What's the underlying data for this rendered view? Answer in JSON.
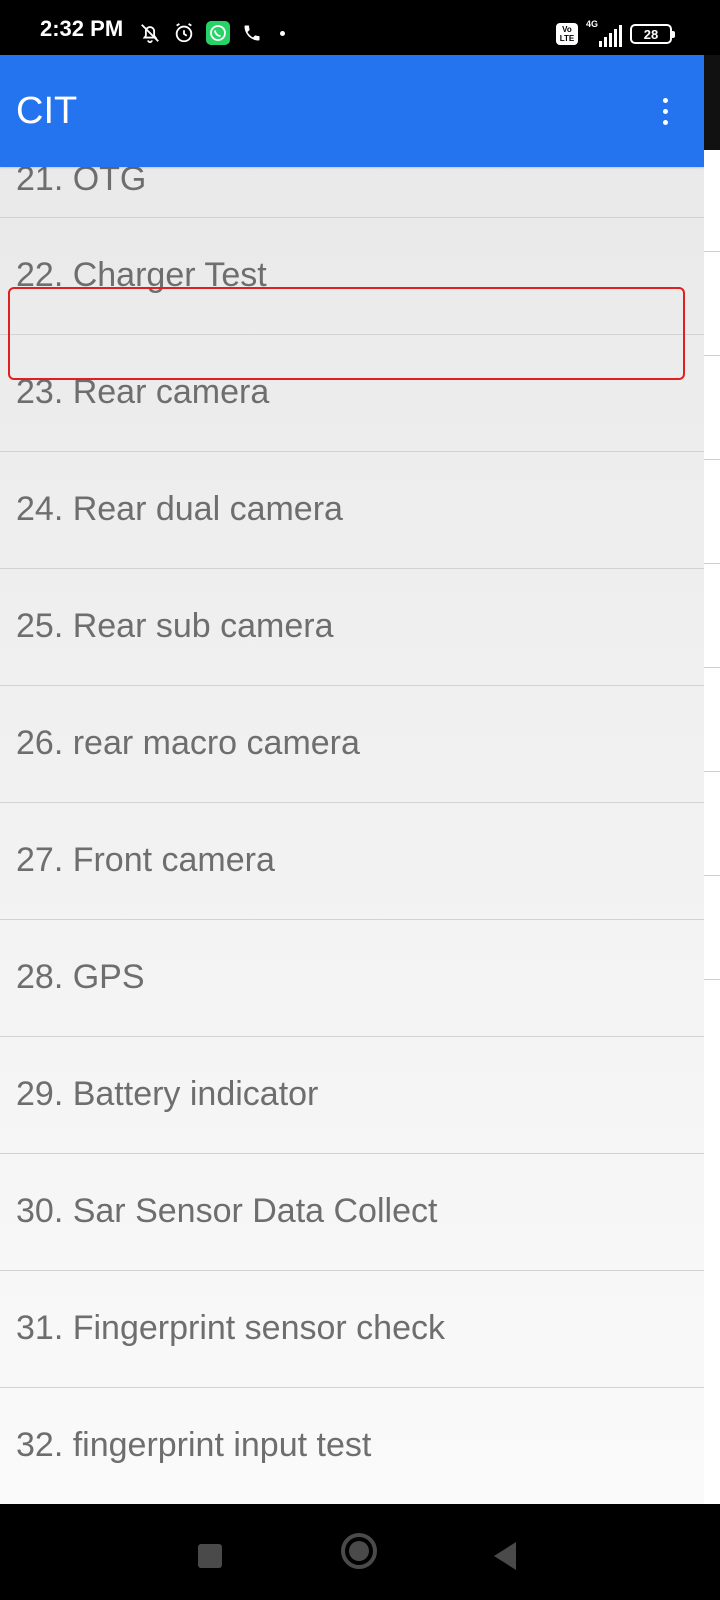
{
  "status_bar": {
    "time": "2:32 PM",
    "network": "4G",
    "volte_top": "Vo",
    "volte_bottom": "LTE",
    "battery": "28",
    "left_icons": [
      "bell-off-icon",
      "alarm-icon",
      "whatsapp-icon",
      "phone-icon"
    ]
  },
  "app_bar": {
    "title": "CIT",
    "overflow_icon": "more-vert-icon"
  },
  "list": {
    "items": [
      {
        "label": "21. OTG"
      },
      {
        "label": "22. Charger Test",
        "highlighted": true
      },
      {
        "label": "23. Rear camera"
      },
      {
        "label": "24. Rear dual camera"
      },
      {
        "label": "25. Rear sub camera"
      },
      {
        "label": "26. rear macro camera"
      },
      {
        "label": "27. Front camera"
      },
      {
        "label": "28. GPS"
      },
      {
        "label": "29. Battery indicator"
      },
      {
        "label": "30. Sar Sensor Data Collect"
      },
      {
        "label": "31. Fingerprint sensor check"
      },
      {
        "label": "32. fingerprint input test"
      }
    ]
  },
  "nav_bar": {
    "buttons": [
      "recents-icon",
      "home-icon",
      "back-icon"
    ]
  },
  "colors": {
    "app_bar": "#2474f0",
    "highlight_border": "#e02020",
    "list_text": "#6e6e6e"
  }
}
